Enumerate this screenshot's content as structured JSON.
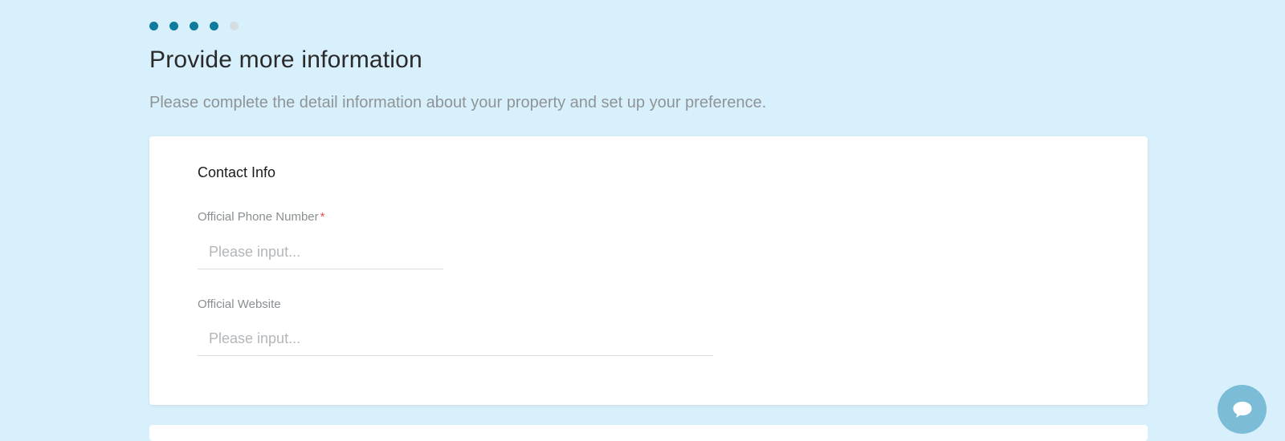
{
  "stepper": {
    "steps": [
      {
        "state": "complete"
      },
      {
        "state": "complete"
      },
      {
        "state": "complete"
      },
      {
        "state": "complete"
      },
      {
        "state": "inactive"
      }
    ],
    "active_color": "#0e7a9e",
    "inactive_color": "#d6dde0"
  },
  "header": {
    "title": "Provide more information",
    "subtitle": "Please complete the detail information about your property and set up your preference."
  },
  "contact_info": {
    "section_title": "Contact Info",
    "phone": {
      "label": "Official Phone Number",
      "required_marker": "*",
      "placeholder": "Please input...",
      "value": ""
    },
    "website": {
      "label": "Official Website",
      "placeholder": "Please input...",
      "value": ""
    }
  },
  "chat": {
    "icon": "chat-bubble-icon",
    "color": "#7bbdd6"
  },
  "colors": {
    "background": "#d8f0fb",
    "required": "#e05555"
  }
}
